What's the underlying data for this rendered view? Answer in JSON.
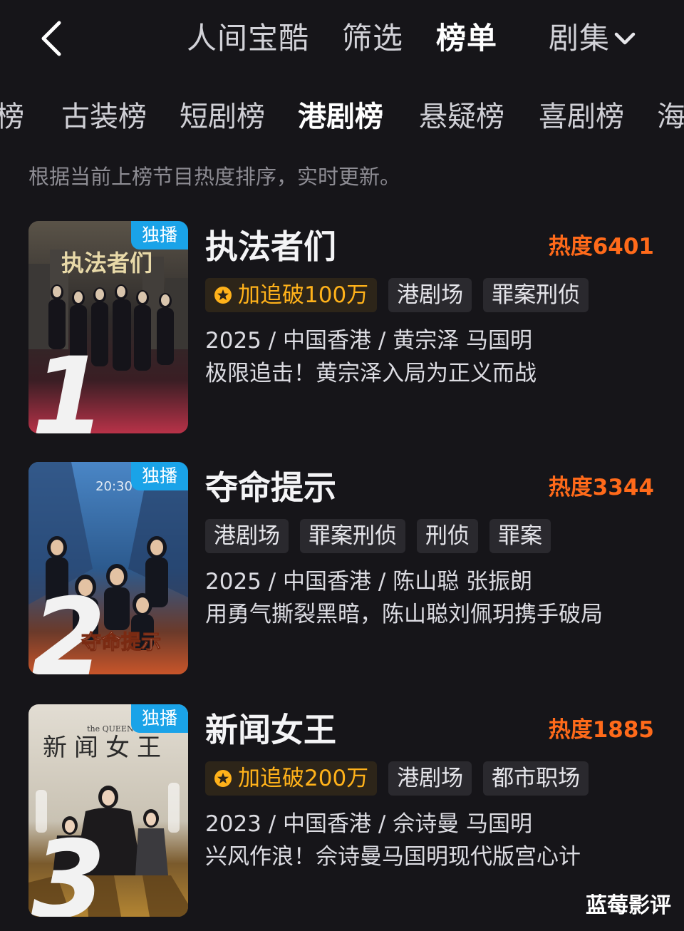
{
  "topnav": {
    "tabs": [
      {
        "label": "人间宝酷"
      },
      {
        "label": "筛选"
      },
      {
        "label": "榜单"
      },
      {
        "label": "剧集"
      }
    ]
  },
  "subtabs": [
    "榜",
    "古装榜",
    "短剧榜",
    "港剧榜",
    "悬疑榜",
    "喜剧榜",
    "海"
  ],
  "description": "根据当前上榜节目热度排序，实时更新。",
  "badge_label": "独播",
  "items": [
    {
      "rank": "1",
      "title": "执法者们",
      "heat": "热度6401",
      "highlight": "加追破100万",
      "tags": [
        "港剧场",
        "罪案刑侦"
      ],
      "meta": "2025 / 中国香港 / 黄宗泽 马国明",
      "slogan": "极限追击！黄宗泽入局为正义而战",
      "poster_title": "执法者们"
    },
    {
      "rank": "2",
      "title": "夺命提示",
      "heat": "热度3344",
      "tags": [
        "港剧场",
        "罪案刑侦",
        "刑侦",
        "罪案"
      ],
      "meta": "2025 / 中国香港 / 陈山聪 张振朗",
      "slogan": "用勇气撕裂黑暗，陈山聪刘佩玥携手破局",
      "poster_title": "夺命提示",
      "poster_time": "20:30"
    },
    {
      "rank": "3",
      "title": "新闻女王",
      "heat": "热度1885",
      "highlight": "加追破200万",
      "tags": [
        "港剧场",
        "都市职场"
      ],
      "meta": "2023 / 中国香港 / 佘诗曼 马国明",
      "slogan": "兴风作浪！佘诗曼马国明现代版宫心计",
      "poster_title": "新闻女王",
      "poster_subtitle": "the QUEEN of news"
    }
  ],
  "watermark": "蓝莓影评",
  "colors": {
    "background": "#161519",
    "heat": "#ff6a1a",
    "highlight": "#ffb21a",
    "badge": "#1aa3e8"
  }
}
